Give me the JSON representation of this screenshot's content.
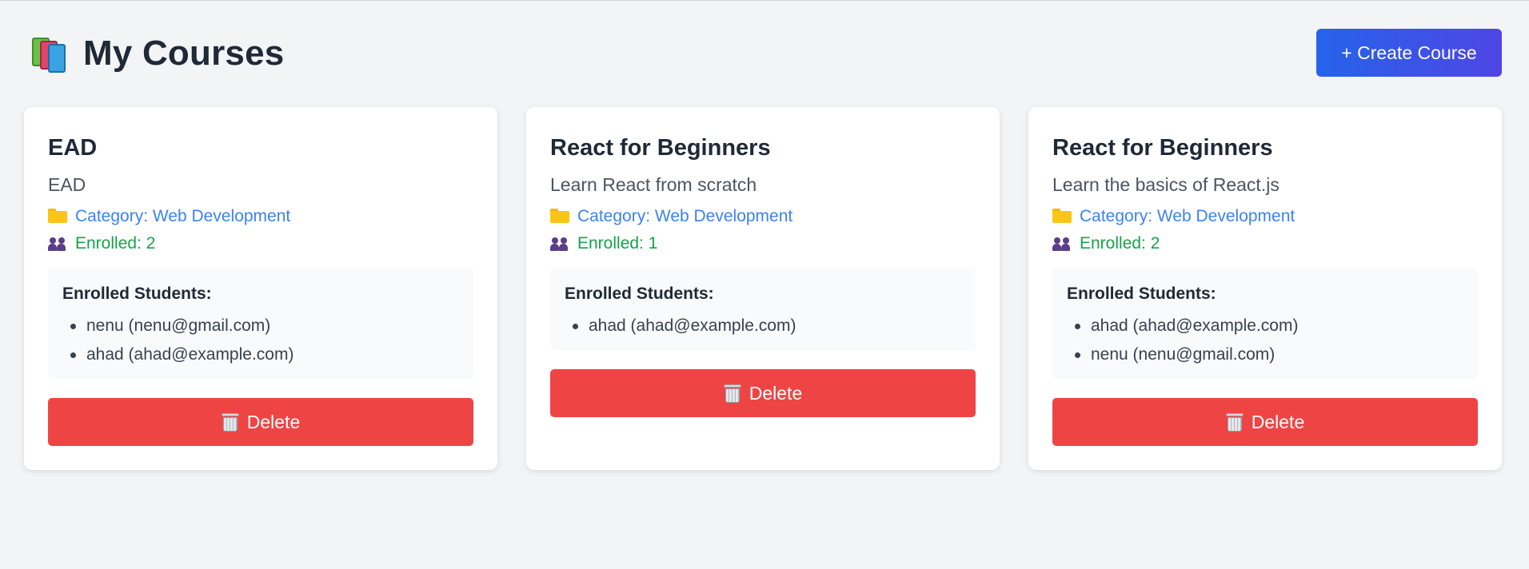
{
  "header": {
    "title": "My Courses",
    "create_button_label": "+ Create Course"
  },
  "colors": {
    "accent_gradient_start": "#2563eb",
    "accent_gradient_end": "#4f46e5",
    "delete": "#ef4444",
    "category": "#3b82f6",
    "enrolled": "#16a34a"
  },
  "courses": [
    {
      "title": "EAD",
      "description": "EAD",
      "category": "Category: Web Development",
      "enrolled": "Enrolled: 2",
      "students_heading": "Enrolled Students:",
      "students": [
        "nenu (nenu@gmail.com)",
        "ahad (ahad@example.com)"
      ],
      "delete_label": "Delete"
    },
    {
      "title": "React for Beginners",
      "description": "Learn React from scratch",
      "category": "Category: Web Development",
      "enrolled": "Enrolled: 1",
      "students_heading": "Enrolled Students:",
      "students": [
        "ahad (ahad@example.com)"
      ],
      "delete_label": "Delete"
    },
    {
      "title": "React for Beginners",
      "description": "Learn the basics of React.js",
      "category": "Category: Web Development",
      "enrolled": "Enrolled: 2",
      "students_heading": "Enrolled Students:",
      "students": [
        "ahad (ahad@example.com)",
        "nenu (nenu@gmail.com)"
      ],
      "delete_label": "Delete"
    }
  ]
}
